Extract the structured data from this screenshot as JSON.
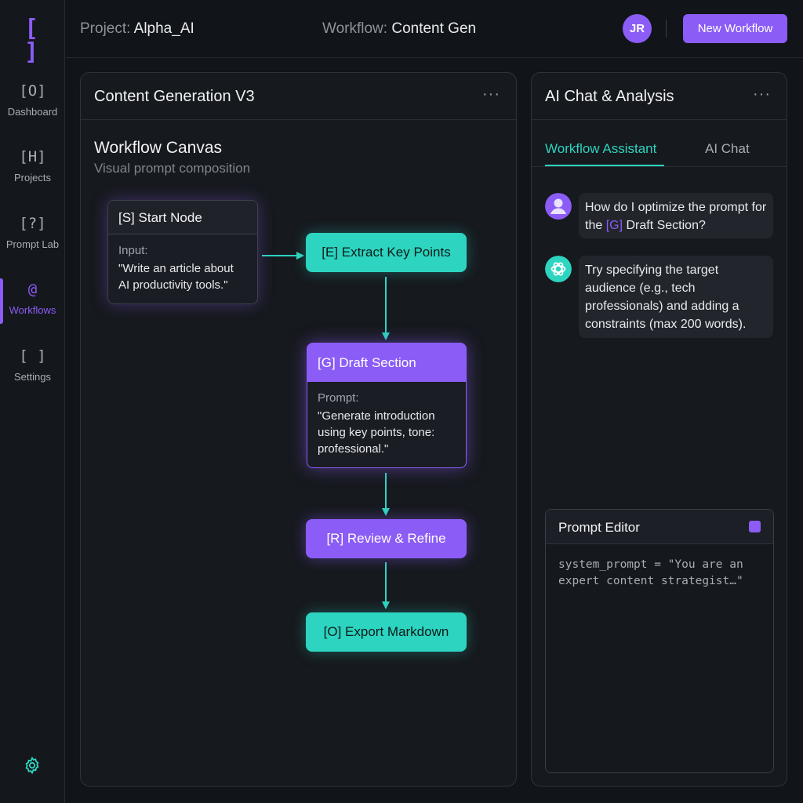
{
  "app": {
    "logo_text": "[ ]"
  },
  "sidebar": {
    "items": [
      {
        "icon": "[O]",
        "label": "Dashboard",
        "active": false
      },
      {
        "icon": "[H]",
        "label": "Projects",
        "active": false
      },
      {
        "icon": "[?]",
        "label": "Prompt Lab",
        "active": false
      },
      {
        "icon": "@",
        "label": "Workflows",
        "active": true
      },
      {
        "icon": "[ ]",
        "label": "Settings",
        "active": false
      }
    ]
  },
  "header": {
    "project_key": "Project:",
    "project_value": "Alpha_AI",
    "workflow_key": "Workflow:",
    "workflow_value": "Content Gen",
    "avatar_initials": "JR",
    "new_workflow_label": "New Workflow"
  },
  "canvas_panel": {
    "title": "Content Generation V3",
    "menu": "···",
    "canvas_title": "Workflow Canvas",
    "canvas_subtitle": "Visual prompt composition",
    "nodes": {
      "start": {
        "title": "[S] Start Node",
        "label": "Input:",
        "text": "\"Write an article about AI productivity tools.\""
      },
      "extract": {
        "title": "[E] Extract Key Points"
      },
      "draft": {
        "title": "[G] Draft Section",
        "label": "Prompt:",
        "text": "\"Generate introduction using key points, tone: professional.\""
      },
      "review": {
        "title": "[R] Review & Refine"
      },
      "export": {
        "title": "[O] Export Markdown"
      }
    }
  },
  "chat_panel": {
    "title": "AI Chat & Analysis",
    "menu": "···",
    "tabs": [
      {
        "label": "Workflow Assistant",
        "active": true
      },
      {
        "label": "AI Chat",
        "active": false
      }
    ],
    "messages": [
      {
        "role": "user",
        "text_before": "How do I optimize the prompt for the ",
        "highlight": "[G]",
        "text_after": " Draft Section?"
      },
      {
        "role": "assistant",
        "text": "Try specifying the target audience (e.g., tech professionals) and adding a constraints (max 200 words)."
      }
    ],
    "editor": {
      "title": "Prompt Editor",
      "code": "system_prompt = \"You are an expert content strategist…\""
    }
  },
  "colors": {
    "accent_purple": "#8b5cf6",
    "accent_teal": "#2dd4bf",
    "background": "#111418"
  }
}
